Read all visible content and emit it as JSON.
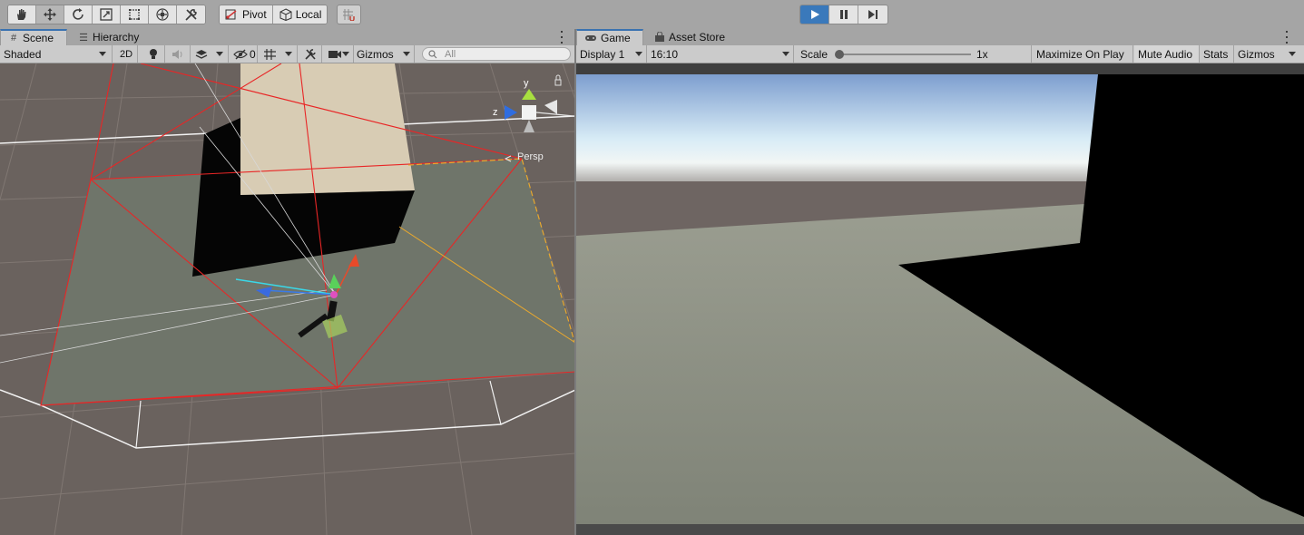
{
  "toolbar": {
    "tools": [
      {
        "name": "hand-tool",
        "icon": "hand-icon"
      },
      {
        "name": "move-tool",
        "icon": "move-icon",
        "active": true
      },
      {
        "name": "rotate-tool",
        "icon": "rotate-icon"
      },
      {
        "name": "scale-tool",
        "icon": "scale-icon"
      },
      {
        "name": "rect-tool",
        "icon": "rect-icon"
      },
      {
        "name": "transform-tool",
        "icon": "transform-icon"
      },
      {
        "name": "custom-tool",
        "icon": "custom-tools-icon"
      }
    ],
    "pivot_label": "Pivot",
    "local_label": "Local",
    "snap_icon": "grid-snap-icon",
    "play_icon": "play-icon",
    "pause_icon": "pause-icon",
    "step_icon": "step-icon"
  },
  "scene_panel": {
    "tabs": [
      {
        "label": "Scene",
        "icon": "grid-icon",
        "active": true
      },
      {
        "label": "Hierarchy",
        "icon": "list-icon",
        "active": false
      }
    ],
    "shading_mode": "Shaded",
    "mode_2d_label": "2D",
    "hidden_count": "0",
    "gizmos_label": "Gizmos",
    "search_placeholder": "All",
    "persp_label": "Persp",
    "axis_labels": {
      "y": "y",
      "z": "z"
    }
  },
  "game_panel": {
    "tabs": [
      {
        "label": "Game",
        "icon": "gamepad-icon",
        "active": true
      },
      {
        "label": "Asset Store",
        "icon": "bag-icon",
        "active": false
      }
    ],
    "display": "Display 1",
    "aspect": "16:10",
    "scale_label": "Scale",
    "scale_value_text": "1x",
    "scale_value": 0,
    "maximize_label": "Maximize On Play",
    "mute_label": "Mute Audio",
    "stats_label": "Stats",
    "gizmos_label": "Gizmos"
  },
  "colors": {
    "accent": "#3a79bb",
    "active_tab_border": "#3a72b0",
    "scene_background": "#6a625e",
    "frustum_lines": "#e82626"
  }
}
